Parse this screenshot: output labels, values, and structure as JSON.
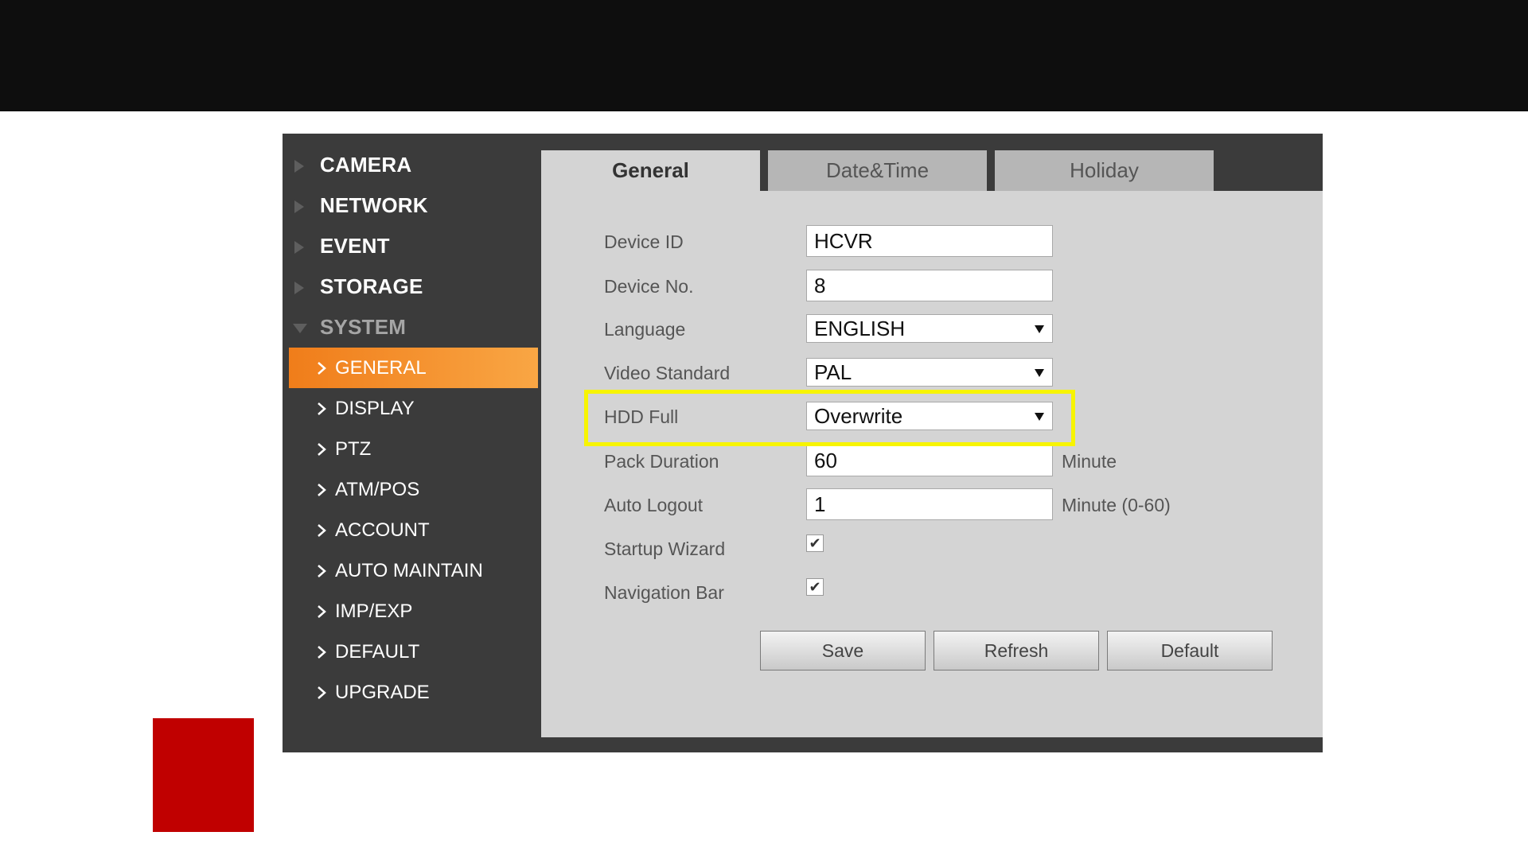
{
  "sidebar": {
    "menus": [
      {
        "label": "CAMERA"
      },
      {
        "label": "NETWORK"
      },
      {
        "label": "EVENT"
      },
      {
        "label": "STORAGE"
      },
      {
        "label": "SYSTEM"
      }
    ],
    "system_items": [
      {
        "label": "GENERAL"
      },
      {
        "label": "DISPLAY"
      },
      {
        "label": "PTZ"
      },
      {
        "label": "ATM/POS"
      },
      {
        "label": "ACCOUNT"
      },
      {
        "label": "AUTO MAINTAIN"
      },
      {
        "label": "IMP/EXP"
      },
      {
        "label": "DEFAULT"
      },
      {
        "label": "UPGRADE"
      }
    ]
  },
  "tabs": [
    {
      "label": "General"
    },
    {
      "label": "Date&Time"
    },
    {
      "label": "Holiday"
    }
  ],
  "form": {
    "device_id": {
      "label": "Device ID",
      "value": "HCVR"
    },
    "device_no": {
      "label": "Device No.",
      "value": "8"
    },
    "language": {
      "label": "Language",
      "value": "ENGLISH"
    },
    "video_standard": {
      "label": "Video Standard",
      "value": "PAL"
    },
    "hdd_full": {
      "label": "HDD Full",
      "value": "Overwrite"
    },
    "pack_duration": {
      "label": "Pack Duration",
      "value": "60",
      "unit": "Minute"
    },
    "auto_logout": {
      "label": "Auto Logout",
      "value": "1",
      "unit": "Minute (0-60)"
    },
    "startup_wizard": {
      "label": "Startup Wizard",
      "checked": true,
      "mark": "✔"
    },
    "navigation_bar": {
      "label": "Navigation Bar",
      "checked": true,
      "mark": "✔"
    }
  },
  "buttons": {
    "save": "Save",
    "refresh": "Refresh",
    "default": "Default"
  },
  "colors": {
    "active_menu": "#f58c2a",
    "highlight": "#f7f400",
    "accent_square": "#c00000"
  }
}
